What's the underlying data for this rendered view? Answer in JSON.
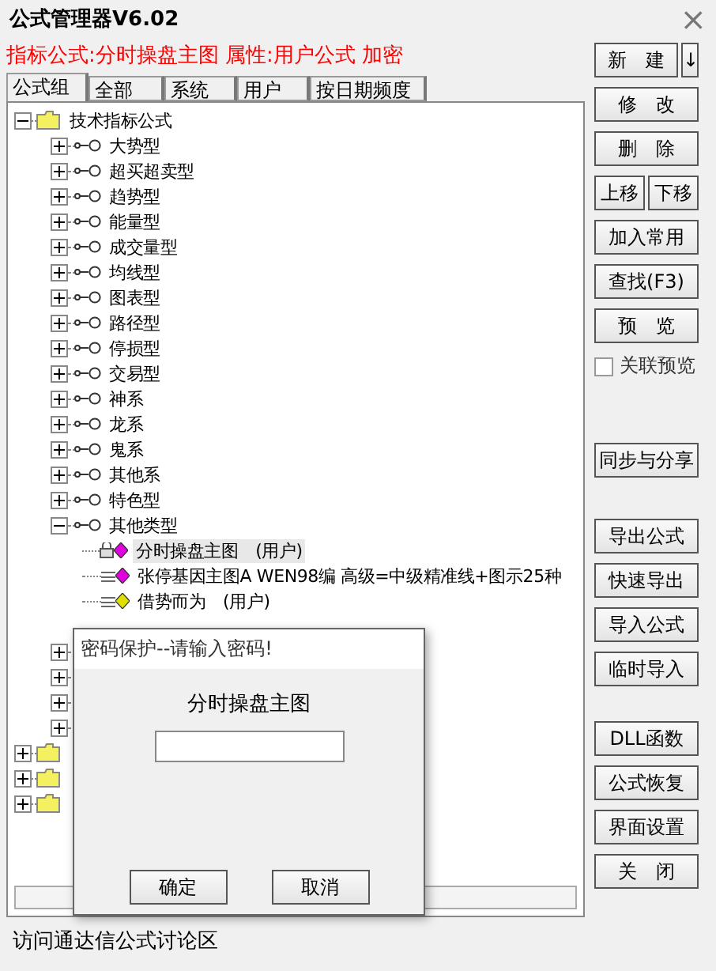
{
  "window": {
    "title": "公式管理器V6.02",
    "close": "×"
  },
  "info_line": "指标公式:分时操盘主图  属性:用户公式  加密",
  "tabs": [
    {
      "label": "公式组",
      "selected": true
    },
    {
      "label": "全部",
      "selected": false
    },
    {
      "label": "系统",
      "selected": false
    },
    {
      "label": "用户",
      "selected": false
    },
    {
      "label": "按日期频度",
      "selected": false
    }
  ],
  "tree": {
    "label": "技术指标公式",
    "expanded": true,
    "children": [
      {
        "label": "大势型",
        "expanded": false
      },
      {
        "label": "超买超卖型",
        "expanded": false
      },
      {
        "label": "趋势型",
        "expanded": false
      },
      {
        "label": "能量型",
        "expanded": false
      },
      {
        "label": "成交量型",
        "expanded": false
      },
      {
        "label": "均线型",
        "expanded": false
      },
      {
        "label": "图表型",
        "expanded": false
      },
      {
        "label": "路径型",
        "expanded": false
      },
      {
        "label": "停损型",
        "expanded": false
      },
      {
        "label": "交易型",
        "expanded": false
      },
      {
        "label": "神系",
        "expanded": false
      },
      {
        "label": "龙系",
        "expanded": false
      },
      {
        "label": "鬼系",
        "expanded": false
      },
      {
        "label": "其他系",
        "expanded": false
      },
      {
        "label": "特色型",
        "expanded": false
      },
      {
        "label": "其他类型",
        "expanded": true,
        "children": [
          {
            "label": "分时操盘主图　(用户)",
            "locked": true,
            "color": "#e000e0",
            "selected": true
          },
          {
            "label": "张停基因主图A  WEN98编 高级=中级精准线+图示25种",
            "locked": false,
            "color": "#e000e0",
            "selected": false
          },
          {
            "label": "借势而为　(用户)",
            "locked": false,
            "color": "#e0e000",
            "selected": false
          }
        ]
      }
    ]
  },
  "buttons": [
    [
      {
        "kind": "split",
        "label": "新　建",
        "arrow": "↓"
      },
      {
        "kind": "button",
        "label": "修　改"
      },
      {
        "kind": "button",
        "label": "删　除"
      },
      {
        "kind": "pair",
        "labels": [
          "上移",
          "下移"
        ]
      },
      {
        "kind": "button",
        "label": "加入常用"
      },
      {
        "kind": "button",
        "label": "查找(F3)"
      },
      {
        "kind": "button",
        "label": "预　览"
      },
      {
        "kind": "checkbox",
        "label": "关联预览",
        "checked": false
      }
    ],
    [
      {
        "kind": "button",
        "label": "同步与分享"
      }
    ],
    [
      {
        "kind": "button",
        "label": "导出公式"
      },
      {
        "kind": "button",
        "label": "快速导出"
      },
      {
        "kind": "button",
        "label": "导入公式"
      },
      {
        "kind": "button",
        "label": "临时导入"
      }
    ],
    [
      {
        "kind": "button",
        "label": "DLL函数"
      },
      {
        "kind": "button",
        "label": "公式恢复"
      },
      {
        "kind": "button",
        "label": "界面设置"
      },
      {
        "kind": "button",
        "label": "关　闭"
      }
    ]
  ],
  "status_bar": "访问通达信公式讨论区",
  "dialog": {
    "title": "密码保护--请输入密码!",
    "label": "分时操盘主图",
    "buttons": [
      "确定",
      "取消"
    ]
  }
}
